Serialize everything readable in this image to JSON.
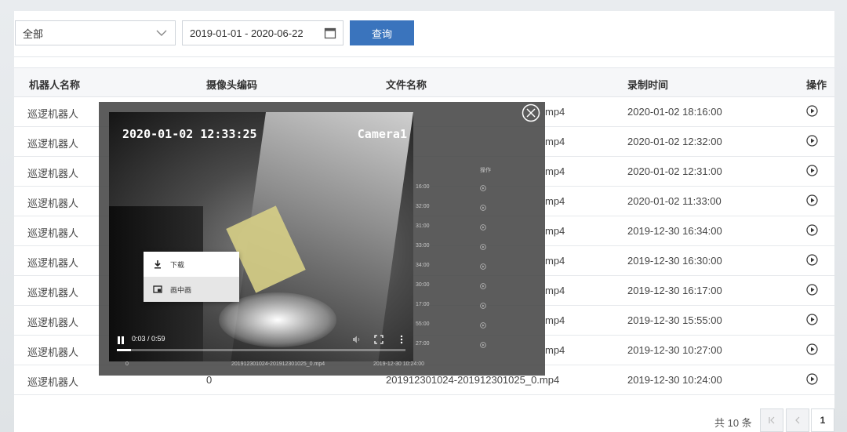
{
  "toolbar": {
    "select_value": "全部",
    "date_range": "2019-01-01 - 2020-06-22",
    "query_label": "查询"
  },
  "table": {
    "headers": [
      "机器人名称",
      "摄像头编码",
      "文件名称",
      "录制时间",
      "操作"
    ],
    "rows": [
      {
        "robot": "巡逻机器人",
        "camera": "",
        "file": "mp4",
        "time": "2020-01-02 18:16:00"
      },
      {
        "robot": "巡逻机器人",
        "camera": "",
        "file": "mp4",
        "time": "2020-01-02 12:32:00"
      },
      {
        "robot": "巡逻机器人",
        "camera": "",
        "file": "mp4",
        "time": "2020-01-02 12:31:00"
      },
      {
        "robot": "巡逻机器人",
        "camera": "",
        "file": "mp4",
        "time": "2020-01-02 11:33:00"
      },
      {
        "robot": "巡逻机器人",
        "camera": "",
        "file": "mp4",
        "time": "2019-12-30 16:34:00"
      },
      {
        "robot": "巡逻机器人",
        "camera": "",
        "file": "mp4",
        "time": "2019-12-30 16:30:00"
      },
      {
        "robot": "巡逻机器人",
        "camera": "",
        "file": "mp4",
        "time": "2019-12-30 16:17:00"
      },
      {
        "robot": "巡逻机器人",
        "camera": "",
        "file": "mp4",
        "time": "2019-12-30 15:55:00"
      },
      {
        "robot": "巡逻机器人",
        "camera": "",
        "file": "mp4",
        "time": "2019-12-30 10:27:00"
      },
      {
        "robot": "巡逻机器人",
        "camera": "0",
        "file": "201912301024-201912301025_0.mp4",
        "time": "2019-12-30 10:24:00"
      }
    ]
  },
  "pagination": {
    "total_label": "共 10 条",
    "current_page": "1"
  },
  "player": {
    "timestamp": "2020-01-02 12:33:25",
    "camera_label": "Camera1",
    "time_display": "0:03 / 0:59",
    "progress": 0.05,
    "menu": {
      "download": "下载",
      "pip": "画中画"
    }
  },
  "ghost_table": {
    "header_op": "操作",
    "times": [
      "16:00",
      "32:00",
      "31:00",
      "33:00",
      "34:00",
      "30:00",
      "17:00",
      "55:00",
      "27:00"
    ],
    "last_camera": "0",
    "last_file": "201912301024-201912301025_0.mp4",
    "last_time": "2019-12-30 10:24:00"
  }
}
